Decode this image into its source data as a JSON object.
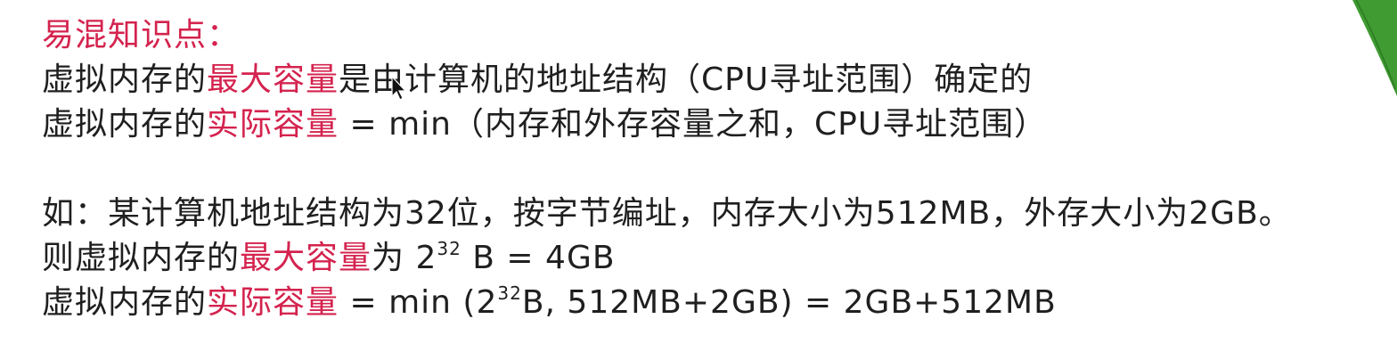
{
  "heading": "易混知识点：",
  "line1": {
    "a": "虚拟内存的",
    "b": "最大容量",
    "c": "是由计算机的地址结构（CPU寻址范围）确定的"
  },
  "line2": {
    "a": "虚拟内存的",
    "b": "实际容量",
    "c": " = min（内存和外存容量之和，CPU寻址范围）"
  },
  "line3": "如：某计算机地址结构为32位，按字节编址，内存大小为512MB，外存大小为2GB。",
  "line4": {
    "a": "则虚拟内存的",
    "b": "最大容量",
    "c": "为 2",
    "sup": "32",
    "d": " B = 4GB"
  },
  "line5": {
    "a": "虚拟内存的",
    "b": "实际容量",
    "c": " = min (2",
    "sup": "32",
    "d": "B, 512MB+2GB) = 2GB+512MB"
  },
  "colors": {
    "highlight": "#d4234e",
    "text": "#1f1f1f",
    "leaf": "#3f9b32"
  },
  "icons": [
    "cursor-arrow-icon",
    "leaf-decoration-icon"
  ]
}
